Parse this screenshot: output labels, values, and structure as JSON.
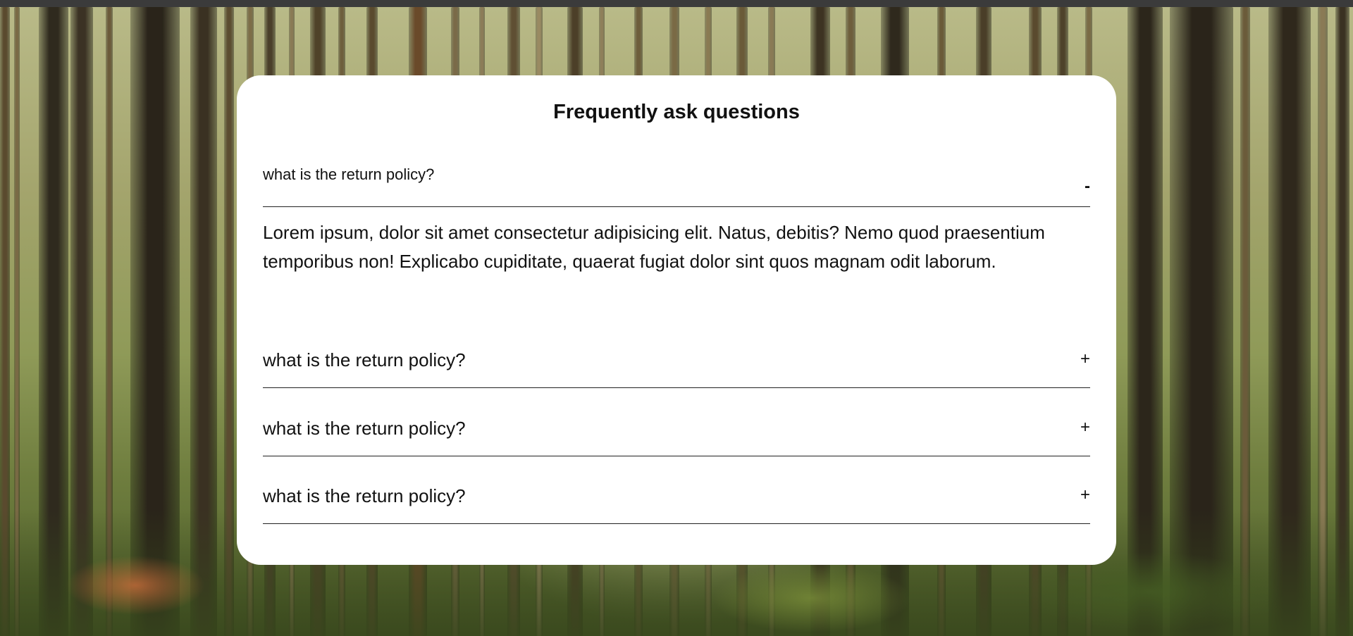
{
  "page": {
    "title": "Frequently ask questions"
  },
  "faq": {
    "items": [
      {
        "question": "what is the return policy?",
        "toggle": "-",
        "expanded": true,
        "answer": "Lorem ipsum, dolor sit amet consectetur adipisicing elit. Natus, debitis? Nemo quod praesentium temporibus non! Explicabo cupiditate, quaerat fugiat dolor sint quos magnam odit laborum."
      },
      {
        "question": "what is the return policy?",
        "toggle": "+",
        "expanded": false
      },
      {
        "question": "what is the return policy?",
        "toggle": "+",
        "expanded": false
      },
      {
        "question": "what is the return policy?",
        "toggle": "+",
        "expanded": false
      }
    ]
  },
  "background": {
    "description_icon": "forest-background-image"
  },
  "colors": {
    "card": "#ffffff",
    "text": "#111111",
    "divider": "#222222"
  }
}
